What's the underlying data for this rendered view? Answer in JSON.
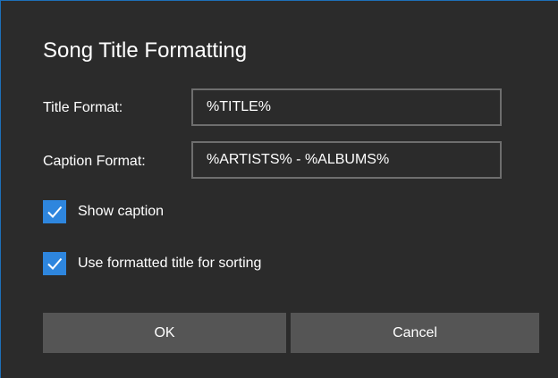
{
  "dialog": {
    "title": "Song Title Formatting",
    "title_format_label": "Title Format:",
    "title_format_value": "%TITLE%",
    "caption_format_label": "Caption Format:",
    "caption_format_value": "%ARTISTS% - %ALBUMS%",
    "show_caption_label": "Show caption",
    "show_caption_checked": true,
    "use_formatted_label": "Use formatted title for sorting",
    "use_formatted_checked": true,
    "ok_label": "OK",
    "cancel_label": "Cancel"
  },
  "icons": {
    "checkbox_check": "checkmark-icon"
  },
  "colors": {
    "background": "#2b2b2b",
    "accent": "#2e86de",
    "button": "#555555",
    "field_border": "#6e6e6e",
    "text": "#ffffff"
  }
}
